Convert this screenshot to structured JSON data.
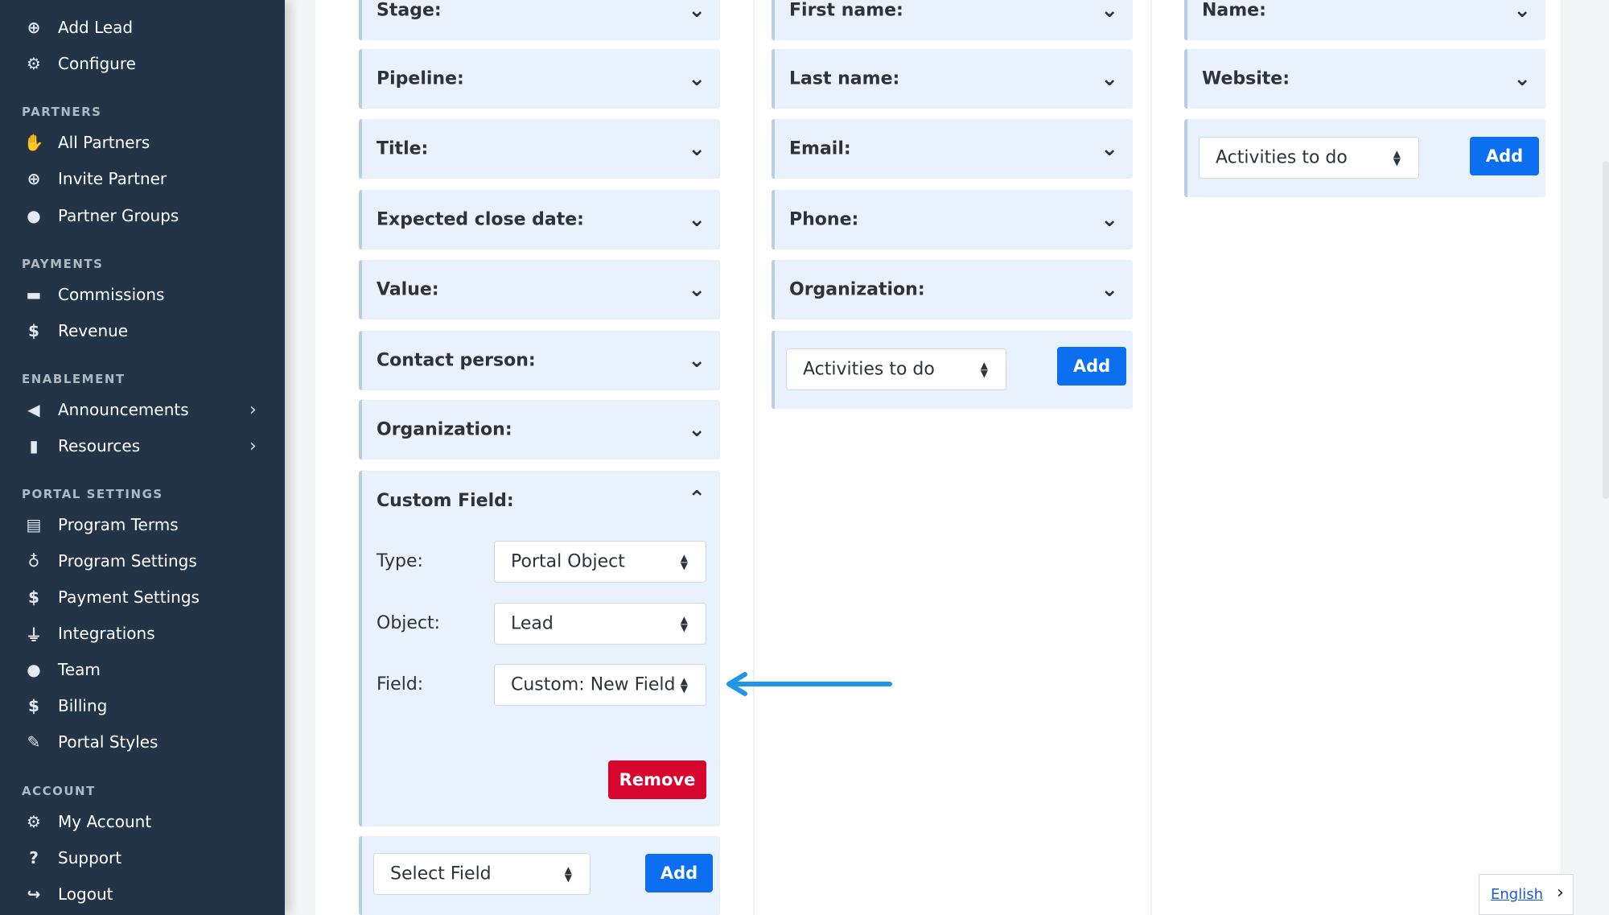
{
  "sidebar": {
    "items_top": [
      {
        "label": "Add Lead",
        "icon": "plus-circle-icon"
      },
      {
        "label": "Configure",
        "icon": "gear-icon"
      }
    ],
    "sections": [
      {
        "title": "PARTNERS",
        "items": [
          {
            "label": "All Partners",
            "icon": "handshake-icon"
          },
          {
            "label": "Invite Partner",
            "icon": "plus-circle-icon"
          },
          {
            "label": "Partner Groups",
            "icon": "users-icon"
          }
        ]
      },
      {
        "title": "PAYMENTS",
        "items": [
          {
            "label": "Commissions",
            "icon": "credit-card-icon"
          },
          {
            "label": "Revenue",
            "icon": "dollar-icon"
          }
        ]
      },
      {
        "title": "ENABLEMENT",
        "items": [
          {
            "label": "Announcements",
            "icon": "megaphone-icon"
          },
          {
            "label": "Resources",
            "icon": "book-icon"
          }
        ]
      },
      {
        "title": "PORTAL SETTINGS",
        "items": [
          {
            "label": "Program Terms",
            "icon": "document-icon"
          },
          {
            "label": "Program Settings",
            "icon": "award-icon"
          },
          {
            "label": "Payment Settings",
            "icon": "dollar-icon"
          },
          {
            "label": "Integrations",
            "icon": "plug-icon"
          },
          {
            "label": "Team",
            "icon": "users-icon"
          },
          {
            "label": "Billing",
            "icon": "dollar-icon"
          },
          {
            "label": "Portal Styles",
            "icon": "brush-icon"
          }
        ]
      },
      {
        "title": "ACCOUNT",
        "items": [
          {
            "label": "My Account",
            "icon": "gear-icon"
          },
          {
            "label": "Support",
            "icon": "question-icon"
          },
          {
            "label": "Logout",
            "icon": "logout-icon"
          }
        ]
      }
    ]
  },
  "columns": {
    "lead": {
      "fields": [
        "Stage:",
        "Pipeline:",
        "Title:",
        "Expected close date:",
        "Value:",
        "Contact person:",
        "Organization:"
      ],
      "custom_field": {
        "title": "Custom Field:",
        "type_label": "Type:",
        "type_value": "Portal Object",
        "object_label": "Object:",
        "object_value": "Lead",
        "field_label": "Field:",
        "field_value": "Custom: New Field",
        "remove_label": "Remove"
      },
      "add_select": "Select Field",
      "add_button": "Add"
    },
    "person": {
      "fields": [
        "First name:",
        "Last name:",
        "Email:",
        "Phone:",
        "Organization:"
      ],
      "add_select": "Activities to do",
      "add_button": "Add"
    },
    "organization": {
      "fields": [
        "Name:",
        "Website:"
      ],
      "add_select": "Activities to do",
      "add_button": "Add"
    }
  },
  "footer": {
    "language": "English"
  },
  "colors": {
    "sidebar_bg": "#243447",
    "panel_bg": "#e8f1fc",
    "primary": "#0b6ff0",
    "danger": "#d6062f",
    "arrow": "#2196e8"
  }
}
